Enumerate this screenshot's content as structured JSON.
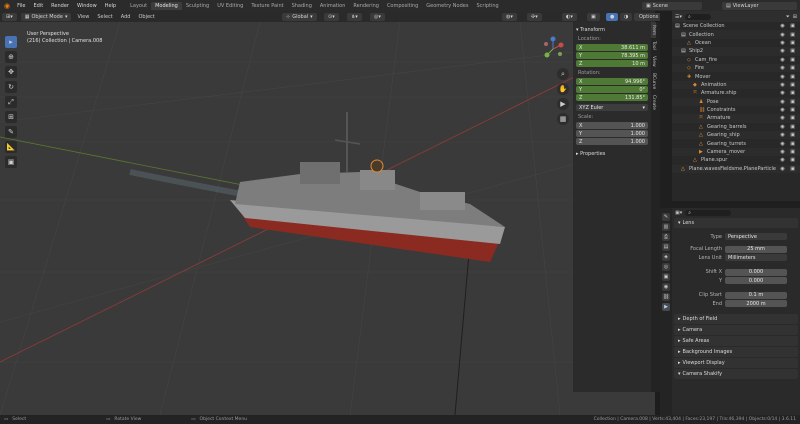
{
  "topbar": {
    "menus": [
      "File",
      "Edit",
      "Render",
      "Window",
      "Help"
    ],
    "workspaces": [
      "Layout",
      "Modeling",
      "Sculpting",
      "UV Editing",
      "Texture Paint",
      "Shading",
      "Animation",
      "Rendering",
      "Compositing",
      "Geometry Nodes",
      "Scripting"
    ],
    "active_workspace": "Modeling",
    "scene": "Scene",
    "view_layer": "ViewLayer"
  },
  "viewport_header": {
    "mode": "Object Mode",
    "menus": [
      "View",
      "Select",
      "Add",
      "Object"
    ],
    "orientation": "Global",
    "options": "Options"
  },
  "viewport": {
    "view_name": "User Perspective",
    "collection_line": "(216) Collection | Camera.008"
  },
  "npanel": {
    "section": "Transform",
    "location_label": "Location:",
    "location": [
      {
        "axis": "X",
        "value": "38.611 m"
      },
      {
        "axis": "Y",
        "value": "78.395 m"
      },
      {
        "axis": "Z",
        "value": "10 m"
      }
    ],
    "rotation_label": "Rotation:",
    "rotation": [
      {
        "axis": "X",
        "value": "94.996°"
      },
      {
        "axis": "Y",
        "value": "0°"
      },
      {
        "axis": "Z",
        "value": "131.85°"
      }
    ],
    "rotation_mode": "XYZ Euler",
    "scale_label": "Scale:",
    "scale": [
      {
        "axis": "X",
        "value": "1.000"
      },
      {
        "axis": "Y",
        "value": "1.000"
      },
      {
        "axis": "Z",
        "value": "1.000"
      }
    ],
    "properties": "Properties",
    "tabs": [
      "Item",
      "Tool",
      "View",
      "BCurve",
      "Create"
    ]
  },
  "outliner": {
    "rows": [
      {
        "indent": 0,
        "label": "Scene Collection",
        "icon": "collection-icon"
      },
      {
        "indent": 1,
        "label": "Collection",
        "icon": "collection-icon"
      },
      {
        "indent": 2,
        "label": "Ocean",
        "icon": "mesh-icon"
      },
      {
        "indent": 1,
        "label": "Ship2",
        "icon": "collection-icon"
      },
      {
        "indent": 2,
        "label": "Cam_fire",
        "icon": "object-icon"
      },
      {
        "indent": 2,
        "label": "Fire",
        "icon": "object-icon"
      },
      {
        "indent": 2,
        "label": "Mover",
        "icon": "empty-icon"
      },
      {
        "indent": 3,
        "label": "Animation",
        "icon": "action-icon"
      },
      {
        "indent": 3,
        "label": "Armature.ship",
        "icon": "armature-icon"
      },
      {
        "indent": 4,
        "label": "Pose",
        "icon": "pose-icon"
      },
      {
        "indent": 4,
        "label": "Constraints",
        "icon": "constraint-icon"
      },
      {
        "indent": 4,
        "label": "Armature",
        "icon": "armature-icon"
      },
      {
        "indent": 4,
        "label": "Gearing_barrels",
        "icon": "mesh-icon"
      },
      {
        "indent": 4,
        "label": "Gearing_ship",
        "icon": "mesh-icon"
      },
      {
        "indent": 4,
        "label": "Gearing_turrets",
        "icon": "mesh-icon"
      },
      {
        "indent": 4,
        "label": "Camera_mover",
        "icon": "camera-icon"
      },
      {
        "indent": 3,
        "label": "Plane.spur",
        "icon": "mesh-icon"
      },
      {
        "indent": 1,
        "label": "Plane.wavesFieldsme.PlaneParticle",
        "icon": "mesh-icon"
      }
    ]
  },
  "properties": {
    "lens_section": "Lens",
    "fields": [
      {
        "label": "Type",
        "value": "Perspective",
        "dropdown": true
      },
      {
        "label": "Focal Length",
        "value": "25 mm"
      },
      {
        "label": "Lens Unit",
        "value": "Millimeters",
        "dropdown": true
      },
      {
        "label": "Shift X",
        "value": "0.000"
      },
      {
        "label": "Y",
        "value": "0.000"
      },
      {
        "label": "Clip Start",
        "value": "0.1 m"
      },
      {
        "label": "End",
        "value": "2000 m"
      }
    ],
    "sections": [
      "Depth of Field",
      "Camera",
      "Safe Areas",
      "Background Images",
      "Viewport Display",
      "Camera Shakify"
    ]
  },
  "status": {
    "select": "Select",
    "rotate": "Rotate View",
    "context": "Object Context Menu",
    "stats": "Collection | Camera.008 | Verts:43,404 | Faces:23,197 | Tris:46,394 | Objects:0/14 | 3.6.11"
  },
  "colors": {
    "accent": "#4772b3",
    "field_green": "#4f7a36",
    "hull_red": "#8b2a20",
    "ship_gray": "#9a9a9a"
  }
}
